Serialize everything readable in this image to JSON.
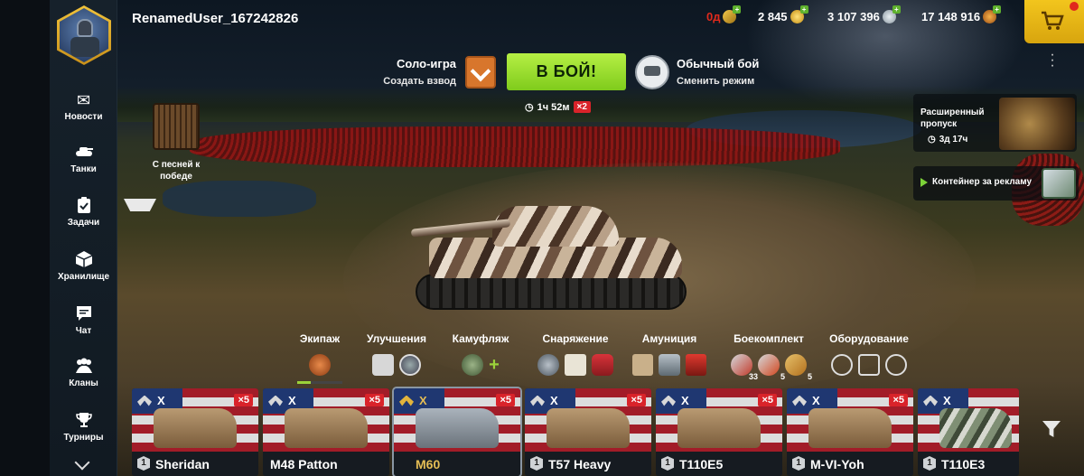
{
  "header": {
    "username": "RenamedUser_167242826",
    "currencies": [
      {
        "id": "days",
        "value": "0д",
        "icon": "premium-days-icon",
        "color": "#e02a1c"
      },
      {
        "id": "gold",
        "value": "2 845",
        "icon": "gold-coin-icon",
        "color": "#ffffff"
      },
      {
        "id": "credits",
        "value": "3 107 396",
        "icon": "credits-coin-icon",
        "color": "#ffffff"
      },
      {
        "id": "free_xp",
        "value": "17 148 916",
        "icon": "free-xp-icon",
        "color": "#ffffff"
      }
    ],
    "shop_icon": "cart-icon"
  },
  "sidebar": {
    "items": [
      {
        "label": "Новости",
        "icon": "envelope-icon"
      },
      {
        "label": "Танки",
        "icon": "tank-icon"
      },
      {
        "label": "Задачи",
        "icon": "clipboard-icon"
      },
      {
        "label": "Хранилище",
        "icon": "box-icon"
      },
      {
        "label": "Чат",
        "icon": "chat-icon"
      },
      {
        "label": "Кланы",
        "icon": "clan-icon"
      },
      {
        "label": "Турниры",
        "icon": "trophy-icon"
      }
    ],
    "more_icon": "chevron-down-icon"
  },
  "battle": {
    "mode_solo": "Соло-игра",
    "create_squad": "Создать взвод",
    "battle_button": "В БОЙ!",
    "mode_name": "Обычный бой",
    "change_mode": "Сменить режим",
    "timer": "1ч 52м",
    "multiplier": "×2"
  },
  "event": {
    "label": "С песней к победе"
  },
  "pass": {
    "title": "Расширенный пропуск",
    "time": "3д 17ч"
  },
  "ad": {
    "label": "Контейнер за рекламу"
  },
  "customization": [
    {
      "label": "Экипаж"
    },
    {
      "label": "Улучшения"
    },
    {
      "label": "Камуфляж"
    },
    {
      "label": "Снаряжение"
    },
    {
      "label": "Амуниция"
    },
    {
      "label": "Боекомплект",
      "counts": [
        "33",
        "5",
        "5"
      ]
    },
    {
      "label": "Оборудование"
    }
  ],
  "tanks": [
    {
      "name": "Sheridan",
      "tier": "X",
      "level": "1",
      "mult": "×5",
      "premium": false
    },
    {
      "name": "M48 Patton",
      "tier": "X",
      "level": "",
      "mult": "×5",
      "premium": false
    },
    {
      "name": "M60",
      "tier": "X",
      "level": "",
      "mult": "×5",
      "premium": true
    },
    {
      "name": "T57 Heavy",
      "tier": "X",
      "level": "1",
      "mult": "×5",
      "premium": false
    },
    {
      "name": "T110E5",
      "tier": "X",
      "level": "1",
      "mult": "×5",
      "premium": false
    },
    {
      "name": "M-VI-Yoh",
      "tier": "X",
      "level": "1",
      "mult": "×5",
      "premium": false
    },
    {
      "name": "T110E3",
      "tier": "X",
      "level": "1",
      "mult": "",
      "premium": false
    }
  ]
}
